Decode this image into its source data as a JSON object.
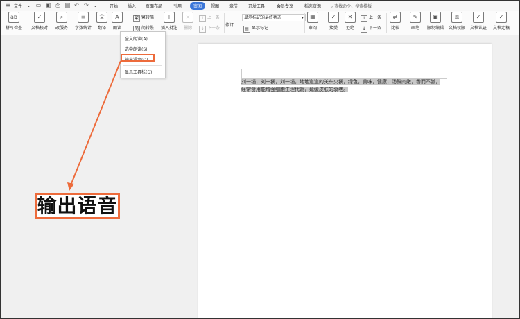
{
  "menu": {
    "file": "文件",
    "tabs": [
      "开始",
      "插入",
      "页面布局",
      "引用",
      "审阅",
      "视图",
      "章节",
      "开发工具",
      "会员专享",
      "稻壳资源"
    ],
    "active_tab": "审阅",
    "search_placeholder": "查找命令、搜索模板"
  },
  "ribbon": {
    "spellcheck": "拼写检查",
    "proofread": "文档校对",
    "rewrite": "改服务",
    "wordcount": "字数统计",
    "translate": "翻译",
    "read_aloud": "朗读",
    "to_traditional": "繁转简",
    "to_simplified": "简转繁",
    "insert_comment": "插入批注",
    "delete": "删除",
    "prev_comment": "上一条",
    "next_comment": "下一条",
    "markup_state": "显示标记的最终状态",
    "revise": "修订",
    "show_markup": "显示标记",
    "review": "审阅",
    "accept": "接受",
    "reject": "拒绝",
    "prev_change": "上一条",
    "next_change": "下一条",
    "compare": "比较",
    "ink": "画笔",
    "restrict_edit": "限制编辑",
    "doc_permission": "文档权限",
    "doc_cert": "文档认证",
    "doc_final": "文档定稿"
  },
  "dropdown": {
    "items": [
      "全文朗读(A)",
      "选中朗读(S)",
      "输出语音(O)",
      "显示工具栏(D)"
    ]
  },
  "document": {
    "line1": "刘一锅，刘一锅，刘一锅，地地道道的关东火锅，绿色，美味，健康，汤鲜肉嫩，香而不腻，",
    "line2": "经常食用能增强细胞生理代谢，延缓皮肤的衰老。"
  },
  "callout": {
    "text": "输出语音"
  },
  "colors": {
    "accent": "#ed6b3b",
    "tab_active": "#3b76d8"
  }
}
